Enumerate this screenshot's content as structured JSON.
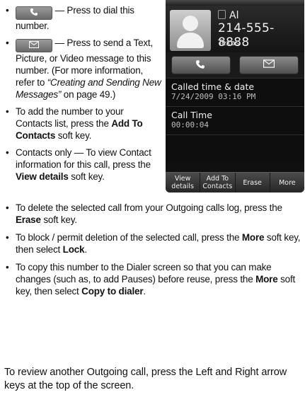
{
  "left": {
    "dial_tail": "— Press to dial this number.",
    "msg_tail_1": "— Press to send a Text, Picture, or Video message to this number. (For more information, refer to ",
    "msg_ref": "“Creating and Sending New Messages”",
    "msg_tail_2": " on page 49.)",
    "add_pre": "To add the number to your Contacts list, press the ",
    "add_key": "Add To Contacts",
    "add_post": " soft key.",
    "view_pre": "Contacts only — To view Contact information for this call, press the ",
    "view_key": "View details",
    "view_post": " soft key."
  },
  "phone": {
    "name": "Al",
    "number": "214-555-8888",
    "location": "Texas",
    "called_label": "Called time & date",
    "called_value": "7/24/2009 03:16 PM",
    "time_label": "Call Time",
    "time_value": "00:00:04",
    "softkeys": [
      "View details",
      "Add To Contacts",
      "Erase",
      "More"
    ]
  },
  "bullets": {
    "erase_pre": "To delete the selected call from your Outgoing calls log, press the ",
    "erase_key": "Erase",
    "erase_post": " soft key.",
    "lock_pre": "To block / permit deletion of the selected call, press the ",
    "lock_key": "More",
    "lock_mid": " soft key, then select ",
    "lock_key2": "Lock",
    "lock_post": ".",
    "copy_pre": "To copy this number to the Dialer screen so that you can make changes (such as, to add Pauses) before reuse, press the ",
    "copy_key": "More",
    "copy_mid": " soft key, then select ",
    "copy_key2": "Copy to dialer",
    "copy_post": "."
  },
  "closing": "To review another Outgoing call, press the Left and Right arrow keys at the top of the screen.",
  "icons": {
    "call": "phone-icon",
    "message": "envelope-icon"
  }
}
